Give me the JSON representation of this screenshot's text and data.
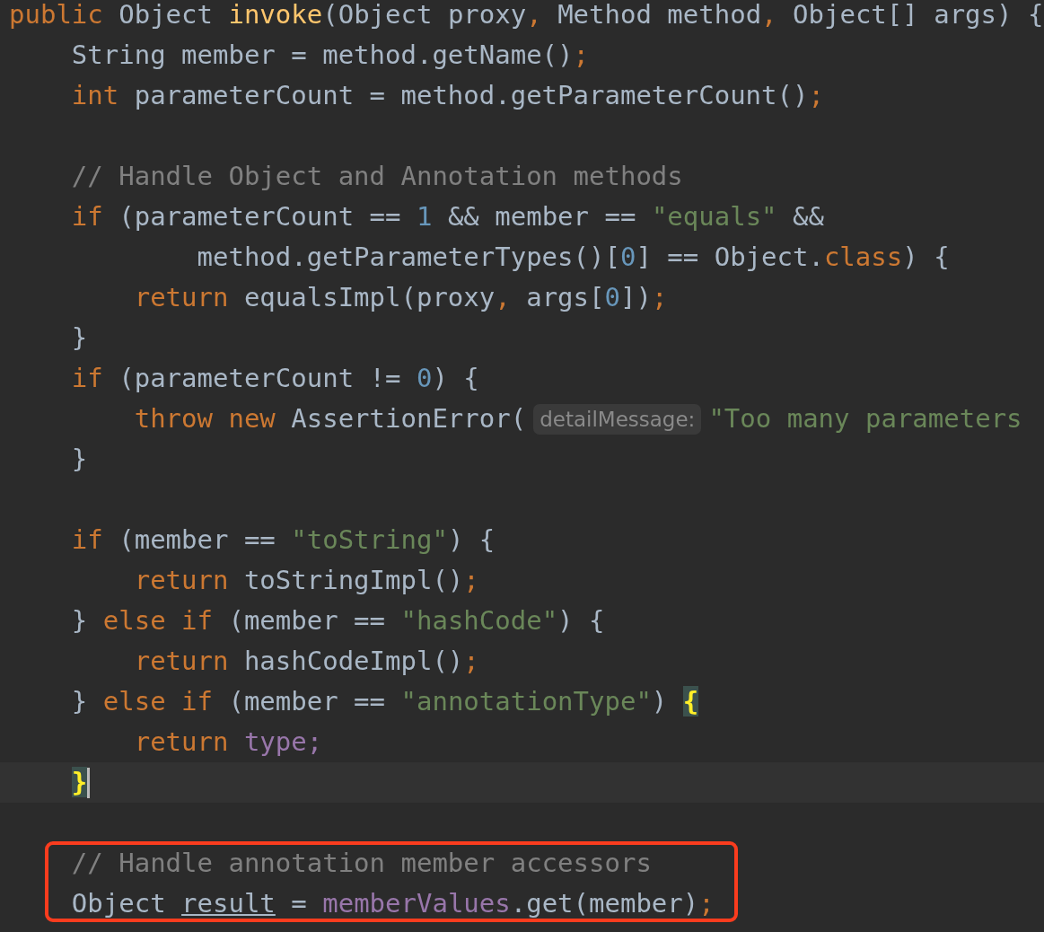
{
  "sections": [
    {
      "lines": [
        {
          "tokens": [
            {
              "kind": "keyword",
              "text": "public"
            },
            {
              "kind": "plain",
              "text": " Object "
            },
            {
              "kind": "function",
              "text": "invoke"
            },
            {
              "kind": "plain",
              "text": "(Object proxy"
            },
            {
              "kind": "keyword",
              "text": ","
            },
            {
              "kind": "plain",
              "text": " Method method"
            },
            {
              "kind": "keyword",
              "text": ","
            },
            {
              "kind": "plain",
              "text": " Object[] args) {"
            }
          ]
        },
        {
          "kind": "code",
          "tokens": [
            {
              "kind": "plain",
              "text": "    String member = method.getName()"
            },
            {
              "kind": "keyword",
              "text": ";"
            }
          ]
        },
        {
          "tokens": [
            {
              "kind": "keyword",
              "text": "    int"
            },
            {
              "kind": "plain",
              "text": " parameterCount = method.getParameterCount()"
            },
            {
              "kind": "keyword",
              "text": ";"
            }
          ]
        },
        {
          "kind": "blank"
        },
        {
          "kind": "code",
          "tokens": [
            {
              "kind": "comment",
              "text": "    // Handle Object and Annotation methods"
            }
          ]
        },
        {
          "tokens": [
            {
              "kind": "keyword",
              "text": "    if"
            },
            {
              "kind": "plain",
              "text": " (parameterCount == "
            },
            {
              "kind": "number",
              "text": "1"
            },
            {
              "kind": "plain",
              "text": " && member == "
            },
            {
              "kind": "string",
              "text": "\"equals\""
            },
            {
              "kind": "plain",
              "text": " &&"
            }
          ]
        },
        {
          "tokens": [
            {
              "kind": "plain",
              "text": "            method.getParameterTypes()["
            },
            {
              "kind": "number",
              "text": "0"
            },
            {
              "kind": "plain",
              "text": "] == Object."
            },
            {
              "kind": "keyword",
              "text": "class"
            },
            {
              "kind": "plain",
              "text": ") {"
            }
          ]
        },
        {
          "tokens": [
            {
              "kind": "keyword",
              "text": "        return"
            },
            {
              "kind": "plain",
              "text": " equalsImpl(proxy"
            },
            {
              "kind": "keyword",
              "text": ","
            },
            {
              "kind": "plain",
              "text": " args["
            },
            {
              "kind": "number",
              "text": "0"
            },
            {
              "kind": "plain",
              "text": "])"
            },
            {
              "kind": "keyword",
              "text": ";"
            }
          ]
        },
        {
          "tokens": [
            {
              "kind": "plain",
              "text": "    }"
            }
          ]
        },
        {
          "tokens": [
            {
              "kind": "keyword",
              "text": "    if"
            },
            {
              "kind": "plain",
              "text": " (parameterCount != "
            },
            {
              "kind": "number",
              "text": "0"
            },
            {
              "kind": "plain",
              "text": ") {"
            }
          ]
        },
        {
          "tokens": [
            {
              "kind": "keyword",
              "text": "        throw new"
            },
            {
              "kind": "plain",
              "text": " AssertionError("
            },
            {
              "kind": "hint",
              "text": "detailMessage:"
            },
            {
              "kind": "string",
              "text": "\"Too many parameters"
            }
          ]
        },
        {
          "tokens": [
            {
              "kind": "plain",
              "text": "    }"
            }
          ]
        },
        {
          "kind": "blank"
        },
        {
          "kind": "code",
          "tokens": [
            {
              "kind": "keyword",
              "text": "    if"
            },
            {
              "kind": "plain",
              "text": " (member == "
            },
            {
              "kind": "string",
              "text": "\"toString\""
            },
            {
              "kind": "plain",
              "text": ") {"
            }
          ]
        },
        {
          "tokens": [
            {
              "kind": "keyword",
              "text": "        return"
            },
            {
              "kind": "plain",
              "text": " toStringImpl()"
            },
            {
              "kind": "keyword",
              "text": ";"
            }
          ]
        },
        {
          "tokens": [
            {
              "kind": "plain",
              "text": "    } "
            },
            {
              "kind": "keyword",
              "text": "else if"
            },
            {
              "kind": "plain",
              "text": " (member == "
            },
            {
              "kind": "string",
              "text": "\"hashCode\""
            },
            {
              "kind": "plain",
              "text": ") {"
            }
          ]
        },
        {
          "tokens": [
            {
              "kind": "keyword",
              "text": "        return"
            },
            {
              "kind": "plain",
              "text": " hashCodeImpl()"
            },
            {
              "kind": "keyword",
              "text": ";"
            }
          ]
        },
        {
          "tokens": [
            {
              "kind": "plain",
              "text": "    } "
            },
            {
              "kind": "keyword",
              "text": "else if"
            },
            {
              "kind": "plain",
              "text": " (member == "
            },
            {
              "kind": "string",
              "text": "\"annotationType\""
            },
            {
              "kind": "plain",
              "text": ") "
            },
            {
              "kind": "brace_match",
              "text": "{"
            }
          ]
        },
        {
          "tokens": [
            {
              "kind": "keyword",
              "text": "        return "
            },
            {
              "kind": "field",
              "text": "type;"
            }
          ]
        },
        {
          "current": true,
          "caret": true,
          "tokens": [
            {
              "kind": "brace_match",
              "text": "    }"
            }
          ]
        },
        {
          "kind": "blank"
        }
      ]
    },
    {
      "boxed": true,
      "lines": [
        {
          "tokens": [
            {
              "kind": "comment",
              "text": "    // Handle annotation member accessors"
            }
          ]
        },
        {
          "tokens": [
            {
              "kind": "plain",
              "text": "    Object "
            },
            {
              "kind": "underlined",
              "text": "result"
            },
            {
              "kind": "plain",
              "text": " = "
            },
            {
              "kind": "field",
              "text": "memberValues"
            },
            {
              "kind": "plain",
              "text": ".get(member)"
            },
            {
              "kind": "keyword",
              "text": ";"
            }
          ]
        }
      ]
    }
  ]
}
